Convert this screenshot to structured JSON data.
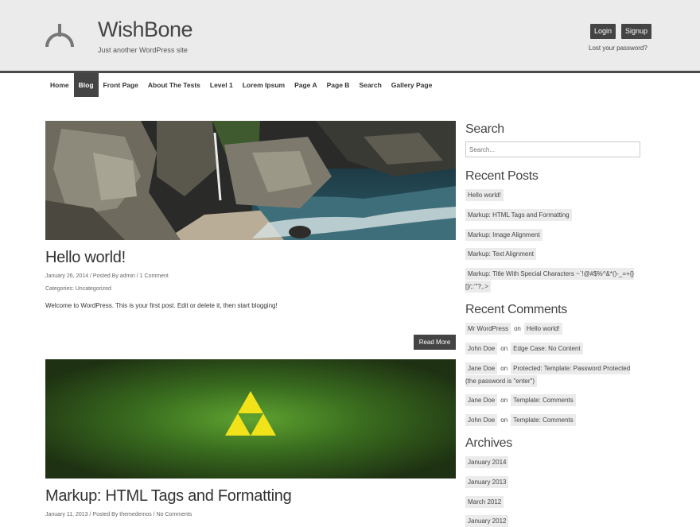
{
  "header": {
    "site_title": "WishBone",
    "tagline": "Just another WordPress site",
    "login_label": "Login",
    "signup_label": "Signup",
    "lost_password": "Lost your password?"
  },
  "nav": {
    "items": [
      "Home",
      "Blog",
      "Front Page",
      "About The Tests",
      "Level 1",
      "Lorem Ipsum",
      "Page A",
      "Page B",
      "Search",
      "Gallery Page"
    ],
    "active": "Blog"
  },
  "posts": [
    {
      "title": "Hello world!",
      "meta": "January 26, 2014 / Posted By admin / 1 Comment",
      "categories": "Categories: Uncategorized",
      "excerpt": "Welcome to WordPress. This is your first post. Edit or delete it, then start blogging!",
      "read_more": "Read More"
    },
    {
      "title": "Markup: HTML Tags and Formatting",
      "meta": "January 11, 2013 / Posted By themedemos / No Comments"
    }
  ],
  "sidebar": {
    "search_title": "Search",
    "search_placeholder": "Search...",
    "recent_posts_title": "Recent Posts",
    "recent_posts": [
      "Hello world!",
      "Markup: HTML Tags and Formatting",
      "Markup: Image Alignment",
      "Markup: Text Alignment",
      "Markup: Title With Special Characters ~`!@#$%^&*()-_=+{}[]/;:'\"?,.>"
    ],
    "recent_comments_title": "Recent Comments",
    "recent_comments": [
      {
        "author": "Mr WordPress",
        "on": "on",
        "post": "Hello world!"
      },
      {
        "author": "John Doe",
        "on": "on",
        "post": "Edge Case: No Content"
      },
      {
        "author": "Jane Doe",
        "on": "on",
        "post": "Protected: Template: Password Protected (the password is \"enter\")"
      },
      {
        "author": "Jane Doe",
        "on": "on",
        "post": "Template: Comments"
      },
      {
        "author": "John Doe",
        "on": "on",
        "post": "Template: Comments"
      }
    ],
    "archives_title": "Archives",
    "archives": [
      "January 2014",
      "January 2013",
      "March 2012",
      "January 2012"
    ]
  },
  "colors": {
    "header_bg": "#ebebeb",
    "dark_accent": "#444444"
  }
}
